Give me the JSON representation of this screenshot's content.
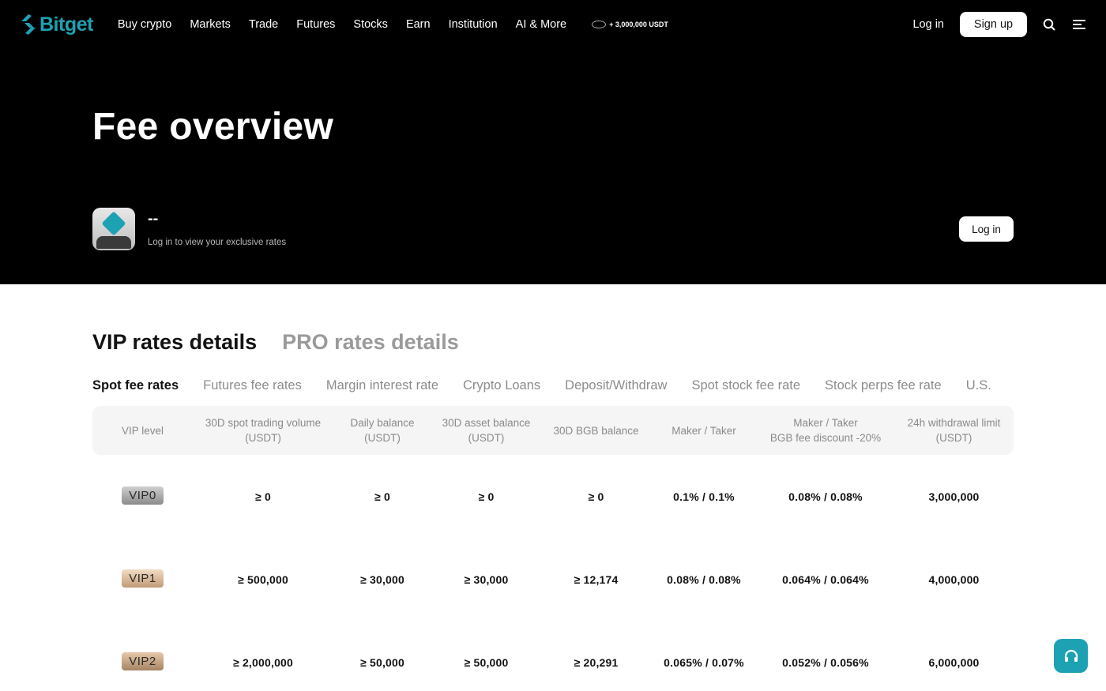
{
  "header": {
    "logo_text": "Bitget",
    "nav": [
      "Buy crypto",
      "Markets",
      "Trade",
      "Futures",
      "Stocks",
      "Earn",
      "Institution",
      "AI & More"
    ],
    "promo_text": "+ 3,000,000 USDT",
    "login_label": "Log in",
    "signup_label": "Sign up",
    "search_icon": "search-icon",
    "menu_icon": "menu-icon"
  },
  "hero": {
    "title": "Fee overview",
    "user_name": "--",
    "user_sub": "Log in to view your exclusive rates",
    "login_label": "Log in"
  },
  "rate_tabs": [
    {
      "label": "VIP rates details",
      "active": true
    },
    {
      "label": "PRO rates details",
      "active": false
    }
  ],
  "sub_tabs": [
    {
      "label": "Spot fee rates",
      "active": true
    },
    {
      "label": "Futures fee rates",
      "active": false
    },
    {
      "label": "Margin interest rate",
      "active": false
    },
    {
      "label": "Crypto Loans",
      "active": false
    },
    {
      "label": "Deposit/Withdraw",
      "active": false
    },
    {
      "label": "Spot stock fee rate",
      "active": false
    },
    {
      "label": "Stock perps fee rate",
      "active": false
    },
    {
      "label": "U.S.",
      "active": false
    }
  ],
  "table": {
    "headers": [
      [
        "VIP level"
      ],
      [
        "30D spot trading volume",
        "(USDT)"
      ],
      [
        "Daily balance",
        "(USDT)"
      ],
      [
        "30D asset balance",
        "(USDT)"
      ],
      [
        "30D BGB balance"
      ],
      [
        "Maker / Taker"
      ],
      [
        "Maker / Taker",
        "BGB fee discount -20%"
      ],
      [
        "24h withdrawal limit",
        "(USDT)"
      ]
    ],
    "rows": [
      [
        "VIP0",
        "≥ 0",
        "≥ 0",
        "≥ 0",
        "≥ 0",
        "0.1% / 0.1%",
        "0.08% / 0.08%",
        "3,000,000"
      ],
      [
        "VIP1",
        "≥ 500,000",
        "≥ 30,000",
        "≥ 30,000",
        "≥ 12,174",
        "0.08% / 0.08%",
        "0.064% / 0.064%",
        "4,000,000"
      ],
      [
        "VIP2",
        "≥ 2,000,000",
        "≥ 50,000",
        "≥ 50,000",
        "≥ 20,291",
        "0.065% / 0.07%",
        "0.052% / 0.056%",
        "6,000,000"
      ]
    ]
  },
  "colors": {
    "brand": "#1DA2B4",
    "hero_bg": "#000000"
  }
}
